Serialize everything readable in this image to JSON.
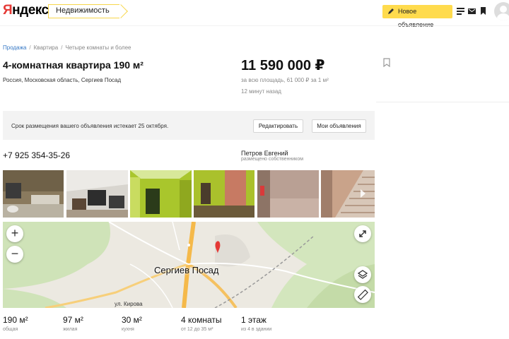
{
  "header": {
    "logo": "Яндекс",
    "service": "Недвижимость",
    "new_ad": "Новое объявление",
    "icons": [
      "pencil-icon",
      "list-icon",
      "mail-icon",
      "bookmark-icon",
      "avatar-icon"
    ]
  },
  "breadcrumbs": [
    "Продажа",
    "Квартира",
    "Четыре комнаты и более"
  ],
  "listing": {
    "title": "4-комнатная квартира 190 м²",
    "address": "Россия, Московская область, Сергиев Посад",
    "price": "11 590 000 ₽",
    "price_note": "за всю площадь, 61 000 ₽ за 1 м²",
    "time_ago": "12 минут назад"
  },
  "notice": {
    "text": "Срок размещения вашего объявления истекает 25 октября.",
    "edit": "Редактировать",
    "my_ads": "Мои объявления"
  },
  "contact": {
    "phone": "+7 925 354-35-26",
    "seller": "Петров Евгений",
    "seller_note": "размещено собственником"
  },
  "photos_count": 6,
  "map": {
    "city": "Сергиев Посад",
    "street": "ул. Кирова",
    "zoom_in": "+",
    "zoom_out": "−"
  },
  "stats": [
    {
      "value": "190 м²",
      "label": "общая"
    },
    {
      "value": "97 м²",
      "label": "жилая"
    },
    {
      "value": "30 м²",
      "label": "кухня"
    },
    {
      "value": "4 комнаты",
      "label": "от 12 до 35 м²"
    },
    {
      "value": "1 этаж",
      "label": "из 4 в здании"
    }
  ],
  "colors": {
    "accent": "#ffdb4d",
    "link": "#3779c5",
    "logo_red": "#e53935"
  }
}
